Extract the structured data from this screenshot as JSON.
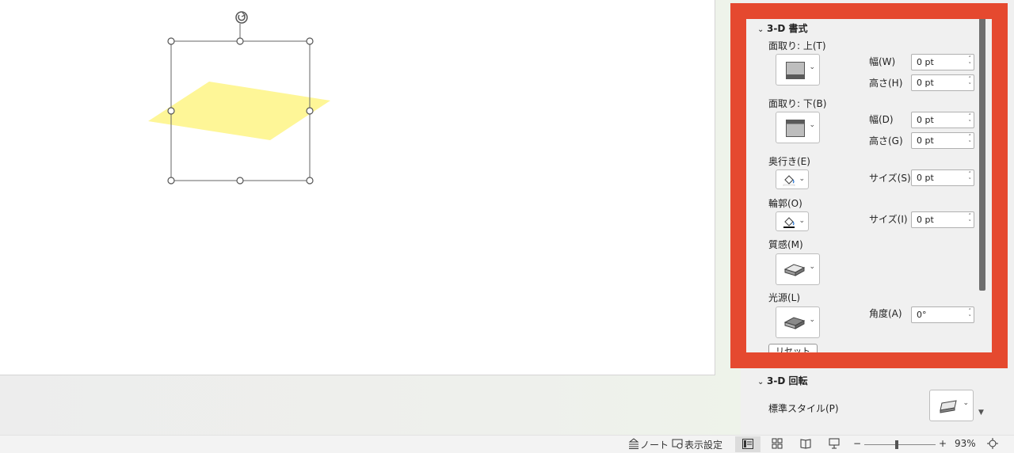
{
  "pane": {
    "section_3d_format": "3-D 書式",
    "bevel_top_label": "面取り: 上(T)",
    "bevel_bottom_label": "面取り: 下(B)",
    "width_top_label": "幅(W)",
    "height_top_label": "高さ(H)",
    "width_bottom_label": "幅(D)",
    "height_bottom_label": "高さ(G)",
    "width_top_value": "0 pt",
    "height_top_value": "0 pt",
    "width_bottom_value": "0 pt",
    "height_bottom_value": "0 pt",
    "depth_label": "奥行き(E)",
    "depth_size_label": "サイズ(S)",
    "depth_size_value": "0 pt",
    "contour_label": "輪郭(O)",
    "contour_size_label": "サイズ(I)",
    "contour_size_value": "0 pt",
    "material_label": "質感(M)",
    "lighting_label": "光源(L)",
    "angle_label": "角度(A)",
    "angle_value": "0°",
    "reset_label": "リセット(R)",
    "section_3d_rotation": "3-D 回転",
    "preset_label": "標準スタイル(P)"
  },
  "statusbar": {
    "notes": "ノート",
    "display_settings": "表示設定",
    "zoom_minus": "−",
    "zoom_plus": "+",
    "zoom": "93%"
  },
  "colors": {
    "highlight": "#e5492f",
    "shape_fill": "#fef697"
  },
  "icons": [
    "rotate-handle-icon",
    "bevel-top-icon",
    "bevel-bottom-icon",
    "paint-bucket-icon",
    "material-icon",
    "lighting-icon",
    "preset-3d-icon",
    "notes-icon",
    "display-settings-icon",
    "normal-view-icon",
    "slide-sorter-icon",
    "reading-view-icon",
    "slideshow-icon",
    "fit-window-icon"
  ]
}
